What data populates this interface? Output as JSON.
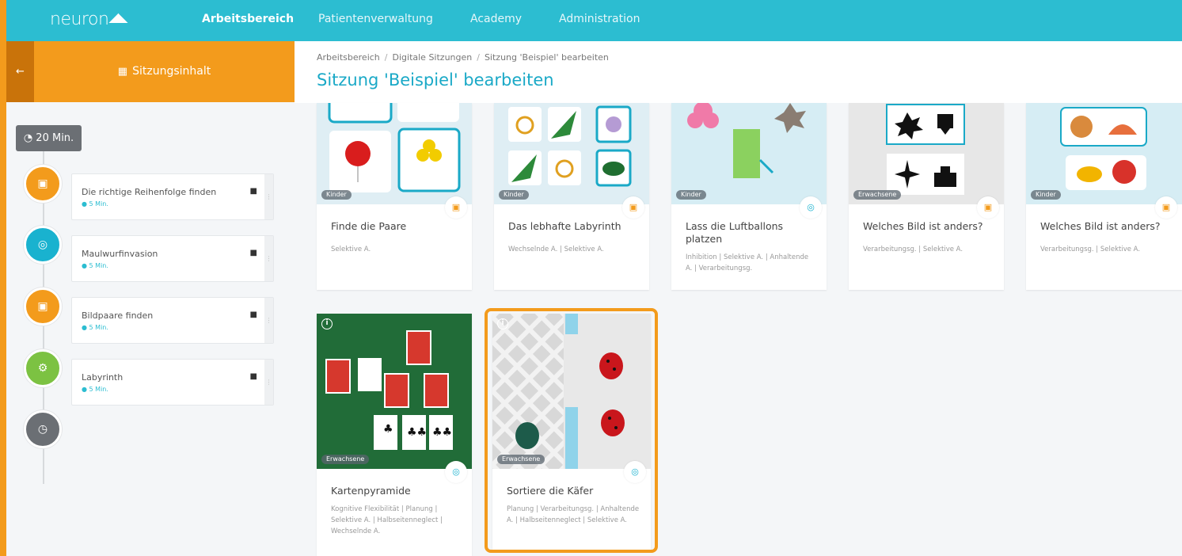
{
  "colors": {
    "accent_orange": "#f39b1c",
    "nav_teal": "#2cbdd1",
    "title_blue": "#1aa9c7",
    "timeline_grey": "#6b6f74",
    "game_blue": "#19b2cf",
    "green": "#7cc242"
  },
  "nav": {
    "logo": "neuron",
    "items": [
      "Arbeitsbereich",
      "Patientenverwaltung",
      "Academy",
      "Administration"
    ],
    "active": "Arbeitsbereich"
  },
  "sidebar": {
    "back_icon": "arrow-left-icon",
    "title": "Sitzungsinhalt",
    "title_icon": "table-icon",
    "total_time": "20 Min.",
    "items": [
      {
        "name": "Die richtige Reihenfolge finden",
        "duration": "5 Min.",
        "icon": "calendar-icon",
        "color": "#f39b1c"
      },
      {
        "name": "Maulwurfinvasion",
        "duration": "5 Min.",
        "icon": "gamepad-icon",
        "color": "#19b2cf"
      },
      {
        "name": "Bildpaare finden",
        "duration": "5 Min.",
        "icon": "calendar-icon",
        "color": "#f39b1c"
      },
      {
        "name": "Labyrinth",
        "duration": "5 Min.",
        "icon": "gears-icon",
        "color": "#7cc242"
      }
    ],
    "end_icon": "clock-icon"
  },
  "main": {
    "breadcrumb": [
      "Arbeitsbereich",
      "Digitale Sitzungen",
      "Sitzung 'Beispiel' bearbeiten"
    ],
    "title": "Sitzung 'Beispiel' bearbeiten",
    "cards": [
      {
        "name": "Finde die Paare",
        "categories": "Selektive A.",
        "audience": "Kinder",
        "type_icon": "calendar-icon"
      },
      {
        "name": "Das lebhafte Labyrinth",
        "categories": "Wechselnde A. | Selektive A.",
        "audience": "Kinder",
        "type_icon": "calendar-icon"
      },
      {
        "name": "Lass die Luftballons platzen",
        "categories": "Inhibition | Selektive A. | Anhaltende A. | Verarbeitungsg.",
        "audience": "Kinder",
        "type_icon": "gamepad-icon"
      },
      {
        "name": "Welches Bild ist anders?",
        "categories": "Verarbeitungsg. | Selektive A.",
        "audience": "Erwachsene",
        "type_icon": "calendar-icon"
      },
      {
        "name": "Welches Bild ist anders?",
        "categories": "Verarbeitungsg. | Selektive A.",
        "audience": "Kinder",
        "type_icon": "calendar-icon"
      },
      {
        "name": "Kartenpyramide",
        "categories": "Kognitive Flexibilität | Planung | Selektive A. | Halbseitenneglect | Wechselnde A.",
        "audience": "Erwachsene",
        "type_icon": "gamepad-icon"
      },
      {
        "name": "Sortiere die Käfer",
        "categories": "Planung | Verarbeitungsg. | Anhaltende A. | Halbseitenneglect | Selektive A.",
        "audience": "Erwachsene",
        "type_icon": "gamepad-icon",
        "highlighted": true
      }
    ]
  }
}
